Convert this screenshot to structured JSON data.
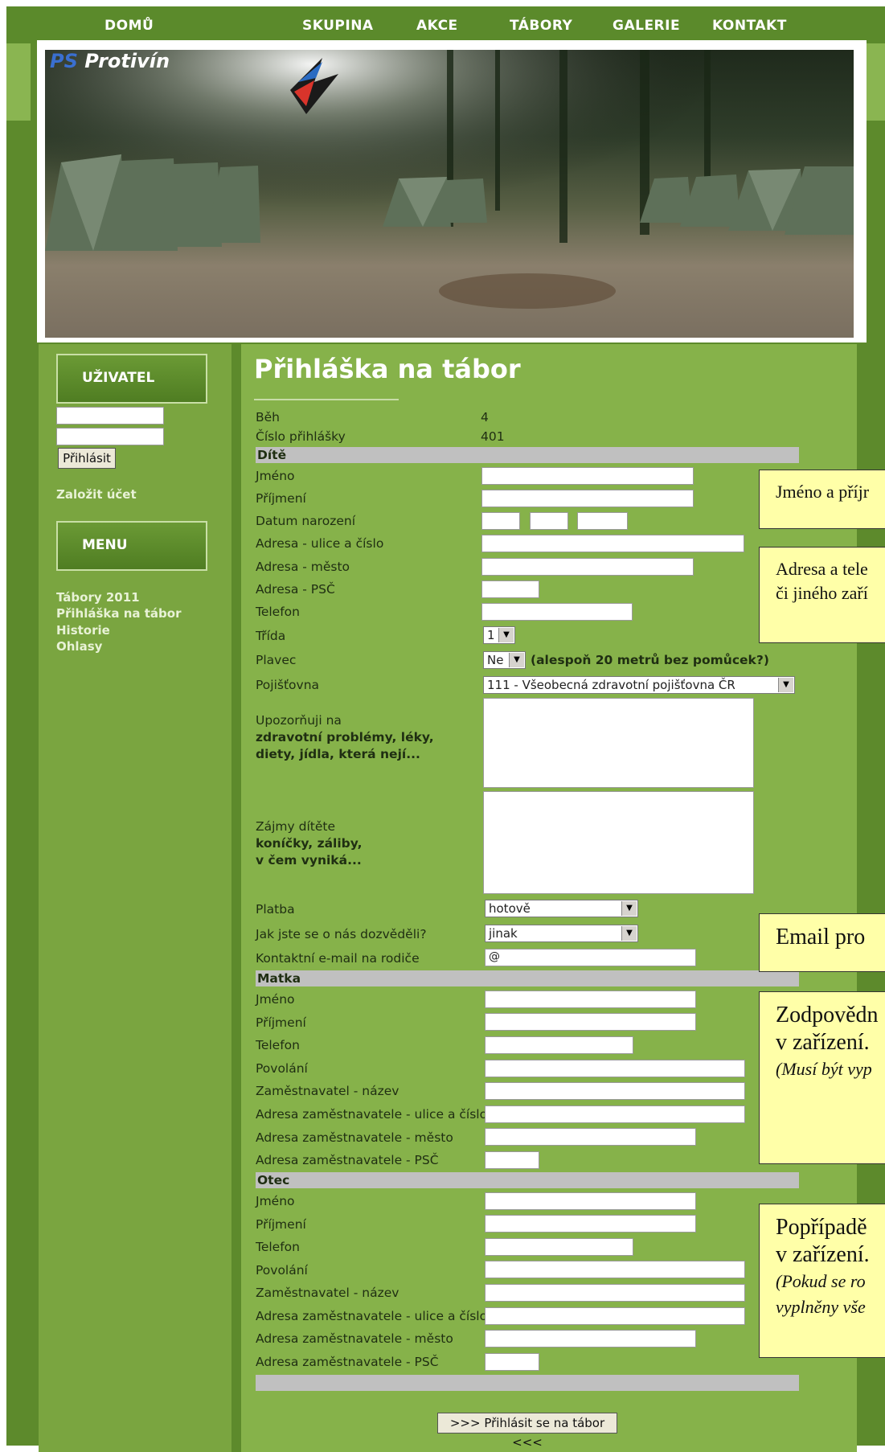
{
  "nav": {
    "home": "DOMŮ",
    "group": "SKUPINA",
    "events": "AKCE",
    "camps": "TÁBORY",
    "gallery": "GALERIE",
    "contact": "KONTAKT"
  },
  "logo": {
    "ps": "PS",
    "name": "Protivín"
  },
  "sidebar": {
    "user_heading": "UŽIVATEL",
    "login_button": "Přihlásit",
    "create_account": "Založit účet",
    "menu_heading": "MENU",
    "menu_items": [
      "Tábory 2011",
      "Přihláška na tábor",
      "Historie",
      "Ohlasy"
    ]
  },
  "form": {
    "title": "Přihláška na tábor",
    "run_label": "Běh",
    "run_value": "4",
    "number_label": "Číslo přihlášky",
    "number_value": "401",
    "child_section": "Dítě",
    "child": {
      "first_name": "Jméno",
      "last_name": "Příjmení",
      "birth_date": "Datum narození",
      "address_street": "Adresa - ulice a číslo",
      "address_city": "Adresa - město",
      "address_zip": "Adresa - PSČ",
      "phone": "Telefon",
      "class_label": "Třída",
      "class_value": "1",
      "swimmer_label": "Plavec",
      "swimmer_value": "Ne",
      "swimmer_hint": "(alespoň 20 metrů bez pomůcek?)",
      "insurance_label": "Pojišťovna",
      "insurance_value": "111 - Všeobecná zdravotní pojišťovna ČR",
      "health_label_1": "Upozorňuji na",
      "health_label_2": "zdravotní problémy, léky,",
      "health_label_3": "diety, jídla, která nejí...",
      "interests_label_1": "Zájmy dítěte",
      "interests_label_2": "koníčky, záliby,",
      "interests_label_3": "v čem vyniká...",
      "payment_label": "Platba",
      "payment_value": "hotově",
      "source_label": "Jak jste se o nás dozvěděli?",
      "source_value": "jinak",
      "email_label": "Kontaktní e-mail na rodiče",
      "email_value": "@"
    },
    "mother_section": "Matka",
    "father_section": "Otec",
    "parent": {
      "first_name": "Jméno",
      "last_name": "Příjmení",
      "phone": "Telefon",
      "job": "Povolání",
      "employer": "Zaměstnavatel - název",
      "employer_street": "Adresa zaměstnavatele - ulice a číslo",
      "employer_city": "Adresa zaměstnavatele - město",
      "employer_zip": "Adresa zaměstnavatele - PSČ"
    },
    "submit": ">>> Přihlásit se na tábor <<<"
  },
  "notes": {
    "n1": "Jméno a příjr",
    "n2_1": "Adresa a tele",
    "n2_2": "či jiného zaří",
    "n3": "Email pro",
    "n4_1": "Zodpovědn",
    "n4_2": " v zařízení.",
    "n4_3": "(Musí být vyp",
    "n5_1": "Popřípadě",
    "n5_2": " v zařízení.",
    "n5_3": "(Pokud se ro",
    "n5_4": "vyplněny vše"
  },
  "colors": {
    "dark_green": "#5d8a2c",
    "light_green": "#86b24a",
    "note_yellow": "#ffffa8",
    "section_gray": "#c0c0c0"
  }
}
